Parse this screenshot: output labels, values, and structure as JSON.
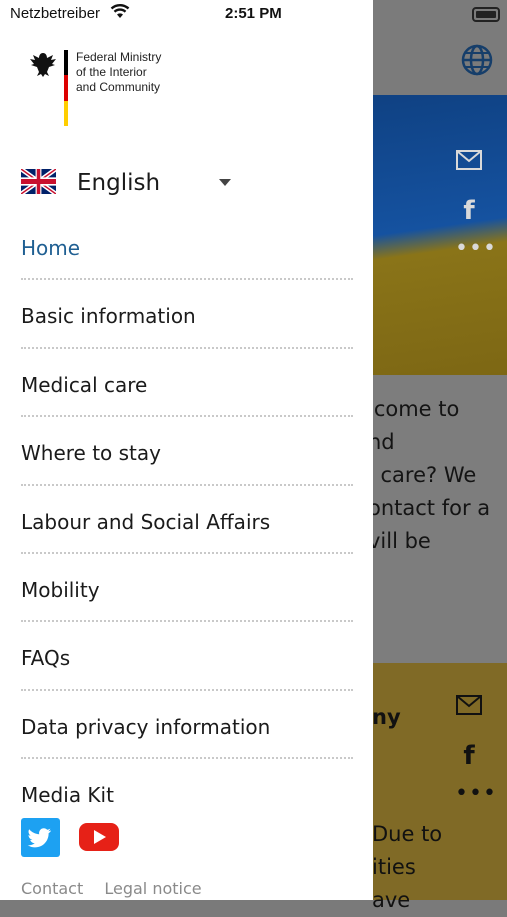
{
  "status_bar": {
    "carrier": "Netzbetreiber",
    "time": "2:51 PM"
  },
  "drawer": {
    "logo_lines": [
      "Federal Ministry",
      "of the Interior",
      "and Community"
    ],
    "language": {
      "selected": "English",
      "flag": "uk-flag"
    },
    "nav_items": [
      {
        "label": "Home",
        "active": true
      },
      {
        "label": "Basic information",
        "active": false
      },
      {
        "label": "Medical care",
        "active": false
      },
      {
        "label": "Where to stay",
        "active": false
      },
      {
        "label": "Labour and Social Affairs",
        "active": false
      },
      {
        "label": "Mobility",
        "active": false
      },
      {
        "label": "FAQs",
        "active": false
      },
      {
        "label": "Data privacy information",
        "active": false
      },
      {
        "label": "Media Kit",
        "active": false
      }
    ],
    "social_icons": [
      "twitter-icon",
      "youtube-icon"
    ],
    "footer_links": [
      "Contact",
      "Legal notice"
    ]
  },
  "background_page": {
    "text_lines": [
      "lcome to",
      "nd",
      "l care? We",
      "ontact for a",
      "vill be"
    ],
    "heading_fragment": "ny",
    "lower_text_lines": [
      "Due to",
      "ities",
      "ave"
    ]
  },
  "colors": {
    "active_nav": "#1f5f92",
    "twitter": "#1da1f2",
    "youtube": "#e62117",
    "flag_black": "#000000",
    "flag_red": "#dd0000",
    "flag_gold": "#ffce00"
  }
}
